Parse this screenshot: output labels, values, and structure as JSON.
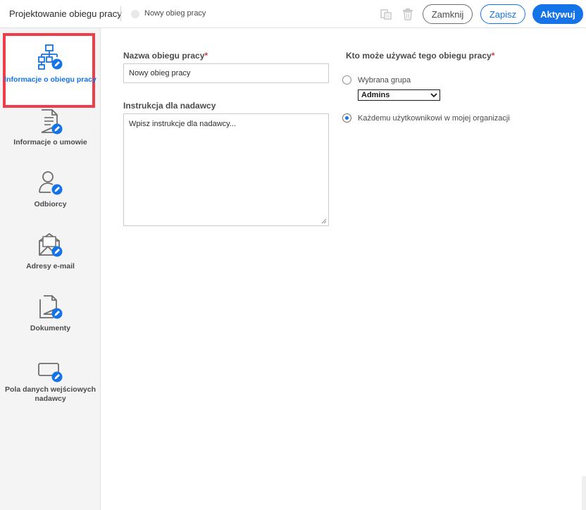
{
  "header": {
    "title": "Projektowanie obiegu pracy",
    "status": "Nowy obieg pracy",
    "close_label": "Zamknij",
    "save_label": "Zapisz",
    "activate_label": "Aktywuj"
  },
  "sidebar": {
    "items": [
      {
        "label": "Informacje o obiegu pracy",
        "icon": "workflow-icon",
        "active": true
      },
      {
        "label": "Informacje o umowie",
        "icon": "document-edit-icon"
      },
      {
        "label": "Odbiorcy",
        "icon": "recipient-icon"
      },
      {
        "label": "Adresy e-mail",
        "icon": "email-icon"
      },
      {
        "label": "Dokumenty",
        "icon": "documents-icon"
      },
      {
        "label": "Pola danych wejściowych nadawcy",
        "icon": "input-field-icon"
      }
    ]
  },
  "form": {
    "name_label": "Nazwa obiegu pracy",
    "name_value": "Nowy obieg pracy",
    "required_mark": "*",
    "instruction_label": "Instrukcja dla nadawcy",
    "instruction_placeholder": "Wpisz instrukcje dla nadawcy...",
    "who_label": "Kto może używać tego obiegu pracy",
    "option_group_label": "Wybrana grupa",
    "group_selected": "Admins",
    "option_everyone_label": "Każdemu użytkownikowi w mojej organizacji"
  },
  "colors": {
    "accent": "#1473e6",
    "highlight": "#ef3e4a"
  }
}
